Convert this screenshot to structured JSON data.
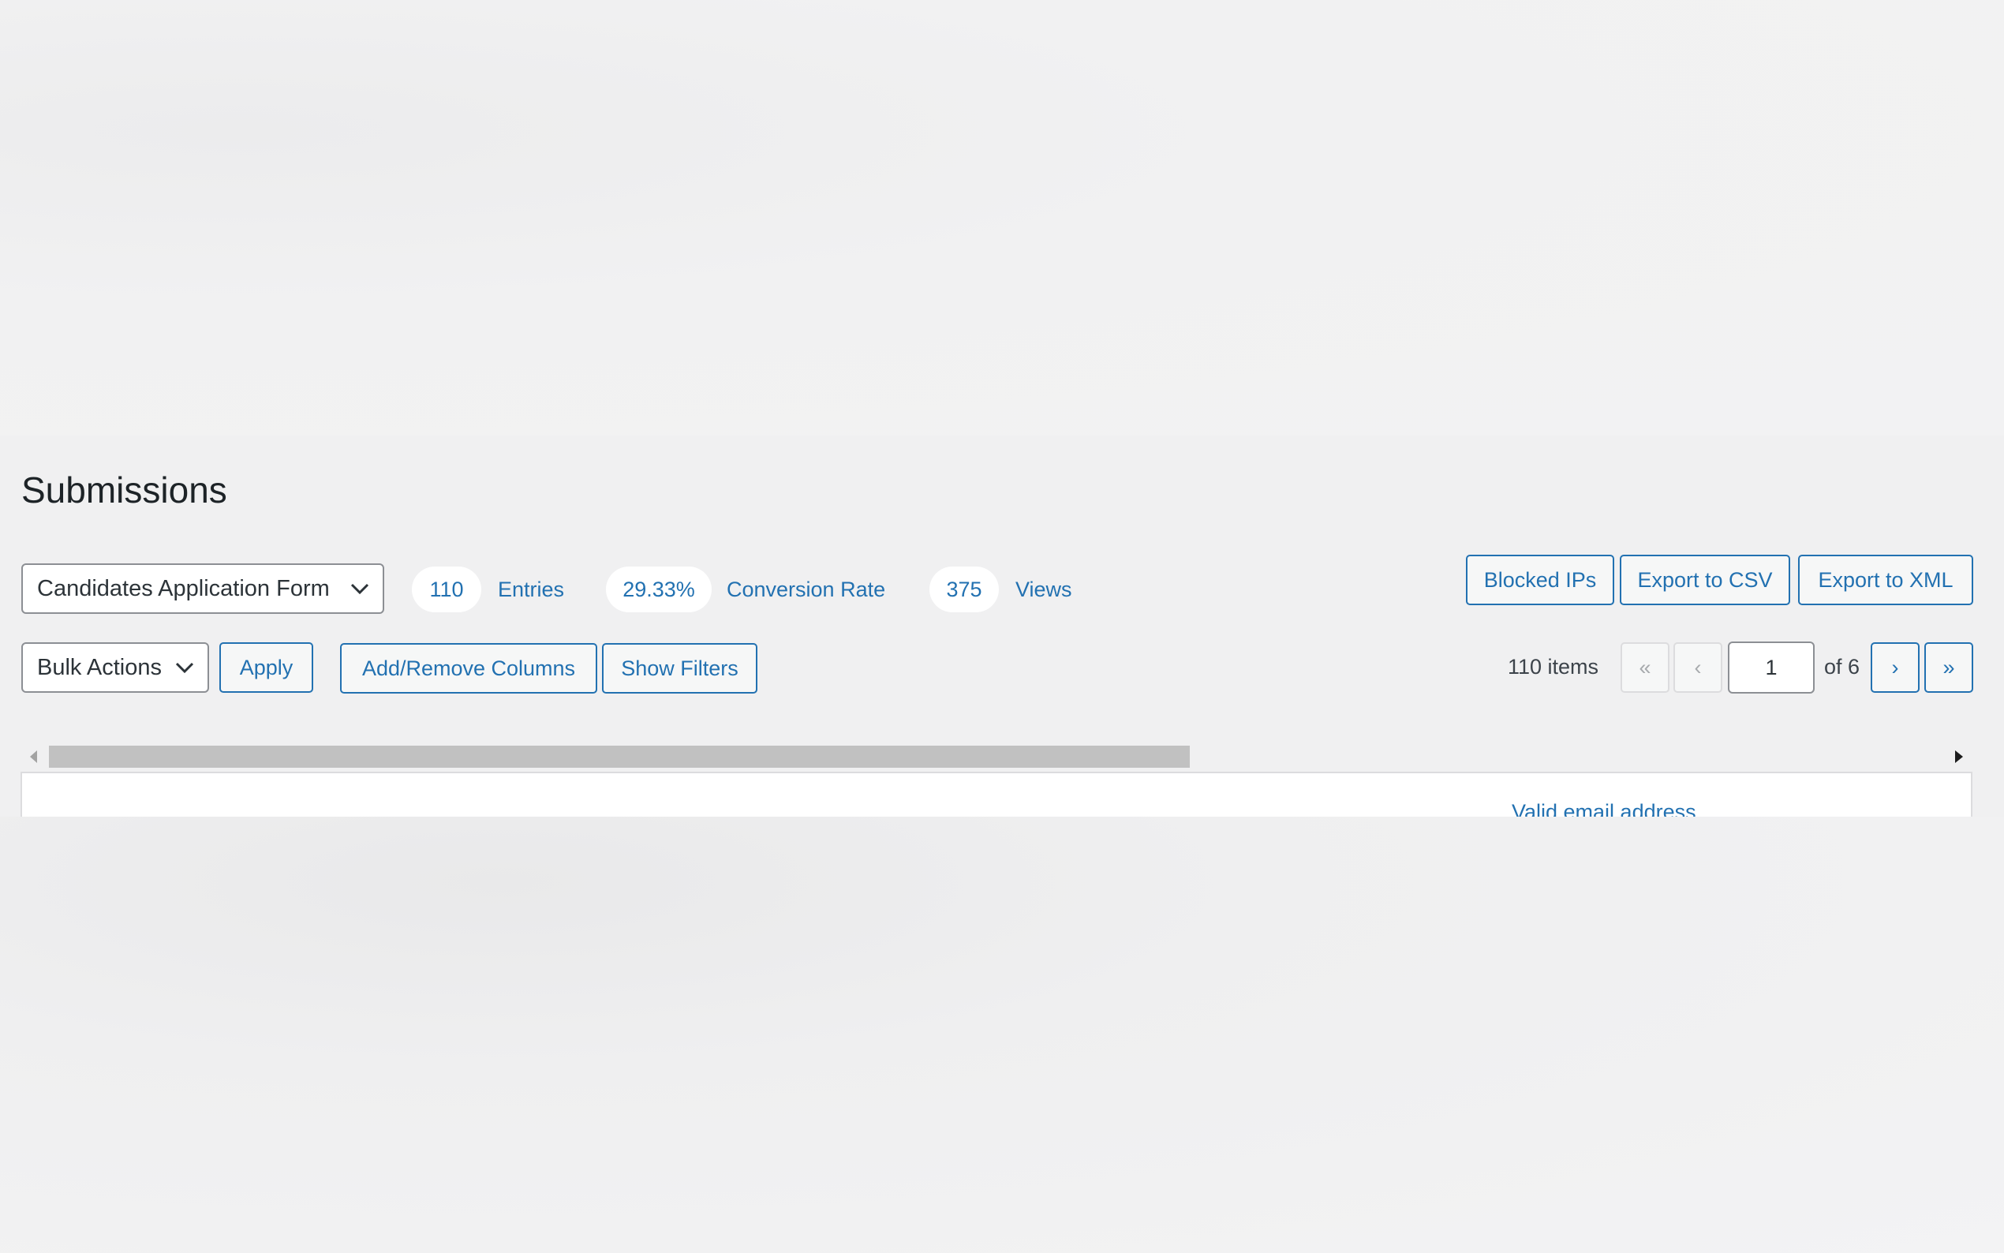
{
  "page": {
    "title": "Submissions"
  },
  "form_select": {
    "value": "Candidates Application Form"
  },
  "stats": [
    {
      "value": "110",
      "label": "Entries"
    },
    {
      "value": "29.33%",
      "label": "Conversion Rate"
    },
    {
      "value": "375",
      "label": "Views"
    }
  ],
  "top_actions": {
    "blocked_ips": "Blocked IPs",
    "export_csv": "Export to CSV",
    "export_xml": "Export to XML"
  },
  "toolbar": {
    "bulk_actions": "Bulk Actions",
    "apply": "Apply",
    "add_remove_columns": "Add/Remove Columns",
    "show_filters": "Show Filters"
  },
  "pagination": {
    "items_count": "110 items",
    "first": "«",
    "prev": "‹",
    "current_page": "1",
    "of_total": "of 6",
    "next": "›",
    "last": "»"
  },
  "table": {
    "visible_header": "Valid email address"
  },
  "scrollbar": {
    "thumb_fraction": 0.6
  },
  "colors": {
    "accent": "#2271b1",
    "background": "#f0f0f1"
  }
}
